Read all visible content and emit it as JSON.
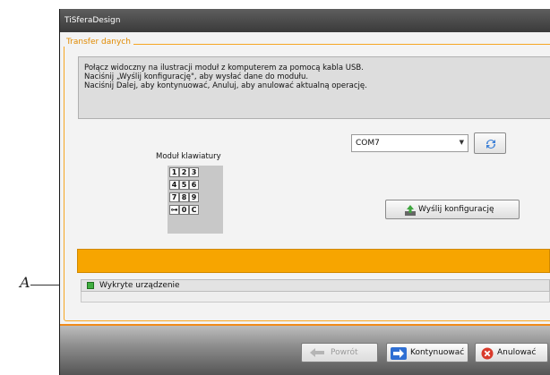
{
  "annotation": {
    "callout_letter": "A"
  },
  "window": {
    "title": "TiSferaDesign"
  },
  "group": {
    "legend": "Transfer danych"
  },
  "instructions": {
    "lines": [
      "Połącz widoczny na ilustracji moduł z komputerem za pomocą kabla USB.",
      "Naciśnij „Wyślij konfigurację\", aby wysłać dane do modułu.",
      "Naciśnij Dalej, aby kontynuować, Anuluj, aby anulować aktualną operację."
    ]
  },
  "keypad": {
    "label": "Moduł klawiatury",
    "rows": [
      [
        "1",
        "2",
        "3"
      ],
      [
        "4",
        "5",
        "6"
      ],
      [
        "7",
        "8",
        "9"
      ],
      [
        "⊶",
        "0",
        "C"
      ]
    ]
  },
  "port": {
    "selected": "COM7"
  },
  "buttons": {
    "send": "Wyślij konfigurację",
    "back": "Powrót",
    "continue": "Kontynuować",
    "cancel": "Anulować"
  },
  "status": {
    "detected_label": "Wykryte urządzenie"
  },
  "colors": {
    "accent": "#f7a500",
    "group_border": "#f6a623",
    "led": "#3fae3f",
    "titlebar": "#4a4a4a"
  },
  "icons": {
    "refresh": "refresh-icon",
    "send": "upload-icon",
    "back": "arrow-left-icon",
    "continue": "arrow-right-icon",
    "cancel": "cancel-icon"
  }
}
